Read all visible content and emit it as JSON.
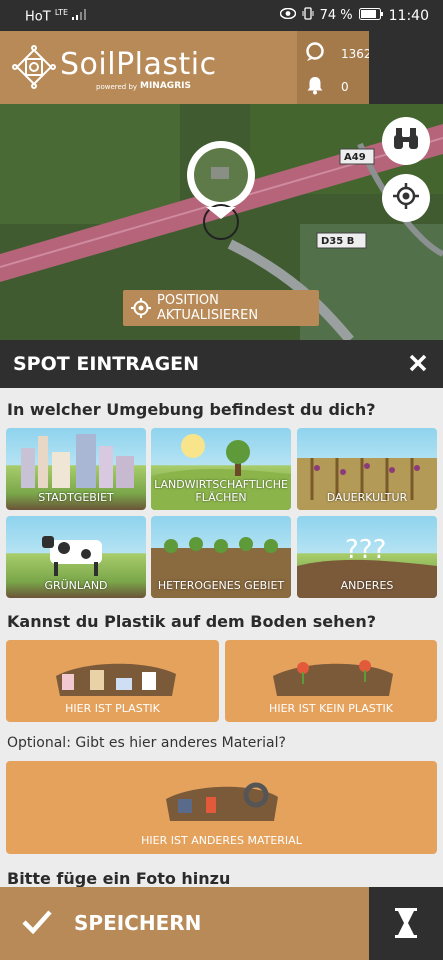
{
  "status_bar": {
    "carrier": "HoT",
    "network": "LTE",
    "battery": "74 %",
    "time": "11:40"
  },
  "header": {
    "logo_name": "SoilPlastic",
    "powered_by": "powered by",
    "brand": "MINAGRIS",
    "spots_count": "1362",
    "notifications_count": "0"
  },
  "map": {
    "road_label_1": "A49",
    "road_label_2": "D35 B",
    "update_position_button": "POSITION AKTUALISIEREN"
  },
  "sheet": {
    "title": "SPOT EINTRAGEN",
    "q_environment": "In welcher Umgebung befindest du dich?",
    "environments": [
      {
        "label": "STADTGEBIET"
      },
      {
        "label": "LANDWIRTSCHAFTLICHE FLÄCHEN"
      },
      {
        "label": "DAUERKULTUR"
      },
      {
        "label": "GRÜNLAND"
      },
      {
        "label": "HETEROGENES GEBIET"
      },
      {
        "label": "ANDERES"
      }
    ],
    "q_plastic": "Kannst du Plastik auf dem Boden sehen?",
    "plastic_yes": "HIER IST PLASTIK",
    "plastic_no": "HIER IST KEIN PLASTIK",
    "optional_label": "Optional: Gibt es hier anderes Material?",
    "other_material": "HIER IST ANDERES MATERIAL",
    "q_photo": "Bitte füge ein Foto hinzu"
  },
  "footer": {
    "save_label": "SPEICHERN"
  },
  "colors": {
    "brand": "#b88a58",
    "dark": "#2f2f2f",
    "button_orange": "#e5a25d"
  }
}
